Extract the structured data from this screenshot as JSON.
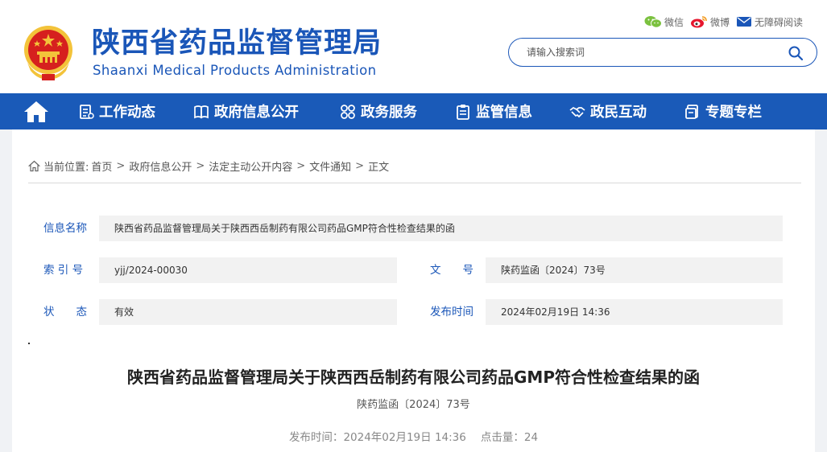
{
  "header": {
    "title": "陕西省药品监督管理局",
    "subtitle": "Shaanxi Medical Products Administration",
    "top_links": [
      {
        "icon": "wechat-icon",
        "label": "微信"
      },
      {
        "icon": "weibo-icon",
        "label": "微博"
      },
      {
        "icon": "mail-icon",
        "label": "无障碍阅读"
      }
    ],
    "search": {
      "placeholder": "请输入搜索词",
      "value": ""
    }
  },
  "nav": {
    "home_icon": "home-icon",
    "items": [
      {
        "icon": "document-list-icon",
        "label": "工作动态"
      },
      {
        "icon": "book-icon",
        "label": "政府信息公开"
      },
      {
        "icon": "grid-rings-icon",
        "label": "政务服务"
      },
      {
        "icon": "clipboard-icon",
        "label": "监管信息"
      },
      {
        "icon": "handshake-icon",
        "label": "政民互动"
      },
      {
        "icon": "folder-icon",
        "label": "专题专栏"
      }
    ]
  },
  "breadcrumb": {
    "prefix": "当前位置:",
    "items": [
      "首页",
      "政府信息公开",
      "法定主动公开内容",
      "文件通知",
      "正文"
    ],
    "separator": ">"
  },
  "info": {
    "name_label": "信息名称",
    "name_value": "陕西省药品监督管理局关于陕西西岳制药有限公司药品GMP符合性检查结果的函",
    "index_label": "索 引 号",
    "index_value": "yjj/2024-00030",
    "docno_label": "文　　号",
    "docno_value": "陕药监函〔2024〕73号",
    "status_label": "状　　态",
    "status_value": "有效",
    "date_label": "发布时间",
    "date_value": "2024年02月19日 14:36"
  },
  "article": {
    "title": "陕西省药品监督管理局关于陕西西岳制药有限公司药品GMP符合性检查结果的函",
    "doc_number": "陕药监函〔2024〕73号",
    "publish_label": "发布时间：",
    "publish_time": "2024年02月19日 14:36",
    "hits_label": "点击量：",
    "hits": "24"
  },
  "colors": {
    "brand_blue": "#1a56b8",
    "nav_blue": "#1a5ab8",
    "emblem_red": "#d6201e",
    "emblem_gold": "#f3c33a"
  }
}
